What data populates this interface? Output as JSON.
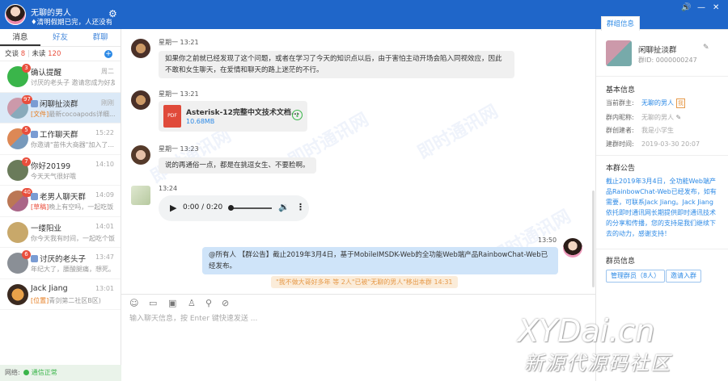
{
  "profile": {
    "name": "无聊的男人",
    "signature": "♦清明假期已完，人还没有..."
  },
  "left_tabs": [
    "消息",
    "好友",
    "群聊"
  ],
  "counts": {
    "talk_label": "交谈",
    "talk_count": "8",
    "unread_label": "未读",
    "unread_count": "120"
  },
  "conversations": [
    {
      "title": "确认提醒",
      "time": "周二",
      "sub": "讨厌的老头子 邀请您成为好友",
      "badge": "3"
    },
    {
      "title": "闲聊扯淡群",
      "time": "刚刚",
      "sub_tag": "[文件]",
      "sub": "最新cocoapods详细...",
      "badge": "97"
    },
    {
      "title": "工作聊天群",
      "time": "15:22",
      "sub": "你邀请\"苗伟大商器\"加入了...",
      "badge": "5"
    },
    {
      "title": "你好20199",
      "time": "14:10",
      "sub": "今天天气很好哦",
      "badge": "7"
    },
    {
      "title": "老男人聊天群",
      "time": "14:09",
      "sub_tag": "[草稿]",
      "sub": "晚上有空吗，一起吃饭",
      "badge": "40"
    },
    {
      "title": "一缕阳业",
      "time": "14:01",
      "sub": "你今天我有时间，一起吃个饭吧",
      "badge": ""
    },
    {
      "title": "讨厌的老头子",
      "time": "13:47",
      "sub": "年纪大了，腰酸腿痛，想死。",
      "badge": "6"
    },
    {
      "title": "Jack Jiang",
      "time": "13:01",
      "sub_tag": "[位置]",
      "sub": "青剑第二社区B区)",
      "badge": ""
    }
  ],
  "status": {
    "label": "网络:",
    "value": "通信正常"
  },
  "messages": {
    "m1_meta": "星期一 13:21",
    "m1_text": "如果你之前就已经发现了这个问题，或者在学习了今天的知识点以后，由于害怕主动开场会陷入同视效应，因此不敢和女生聊天，在爱情和聊天的路上迷茫的不行。",
    "m2_meta": "星期一 13:21",
    "m2_file_name": "Asterisk-12完整中文技术文档...",
    "m2_file_size": "10.68MB",
    "m3_meta": "星期一 13:23",
    "m3_text": "说的再通俗一点，都是在挑逗女生、不要脸啊。",
    "m4_meta": "13:24",
    "m4_audio_time": "0:00 / 0:20",
    "m5_meta": "13:50",
    "m5_text": "@所有人 【群公告】截止2019年3月4日，基于MobileIMSDK-Web的全功能Web端产品RainbowChat-Web已经发布。",
    "system_note": "\"我不做大哥好多年 等 2人\"已被\"无聊的男人\"移出本群",
    "system_time": "14:31"
  },
  "composer": {
    "placeholder": "输入聊天信息，按 Enter 键快速发送 ..."
  },
  "right": {
    "tab": "群组信息",
    "group_name": "闲聊扯淡群",
    "group_id": "群ID: 0000000247",
    "basic_title": "基本信息",
    "owner_label": "当前群主:",
    "owner_value": "无聊的男人",
    "owner_tag": "我",
    "nick_label": "群内昵称:",
    "nick_value": "无聊的男人",
    "creator_label": "群创建者:",
    "creator_value": "我是小学生",
    "created_label": "建群时间:",
    "created_value": "2019-03-30 20:07",
    "notice_title": "本群公告",
    "notice_text": "截止2019年3月4日，全功能Web端产品RainbowChat-Web已经发布，如有需要，可联系Jack Jiang。Jack Jiang依托即时通讯网长期提供即时通讯技术的分享和传播，您的支持是我们继续下去的动力，感谢支持！",
    "members_title": "群员信息",
    "manage_btn": "管理群员（8人）",
    "invite_btn": "邀请入群"
  },
  "watermark": {
    "logo": "XYDai.cn",
    "logo_sub": "新源代源码社区",
    "bg_text": "即时通讯网"
  }
}
